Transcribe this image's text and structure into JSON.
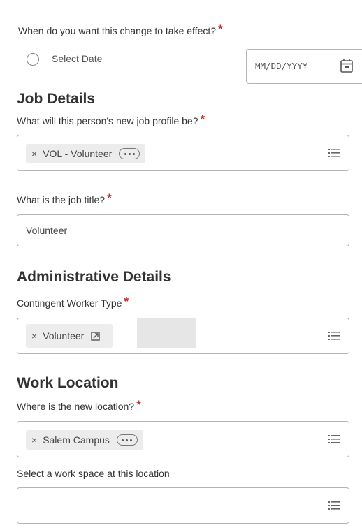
{
  "effective_date": {
    "question": "When do you want this change to take effect?",
    "required_mark": "*",
    "radio_label": "Select Date",
    "date_placeholder": "MM/DD/YYYY"
  },
  "job_details": {
    "heading": "Job Details",
    "profile_question": "What will this person's new job profile be?",
    "profile_value": "VOL - Volunteer",
    "title_question": "What is the job title?",
    "title_value": "Volunteer"
  },
  "admin_details": {
    "heading": "Administrative Details",
    "worker_type_label": "Contingent Worker Type",
    "worker_type_value": "Volunteer"
  },
  "work_location": {
    "heading": "Work Location",
    "location_question": "Where is the new location?",
    "location_value": "Salem Campus",
    "workspace_label": "Select a work space at this location",
    "workspace_value": ""
  },
  "icons": {
    "remove": "×",
    "list": "list-icon",
    "calendar": "calendar-icon",
    "more": "ellipsis-icon",
    "external": "external-link-icon"
  },
  "colors": {
    "required": "#c62828",
    "pill_bg": "#ececec",
    "border": "#b5b5b5"
  }
}
